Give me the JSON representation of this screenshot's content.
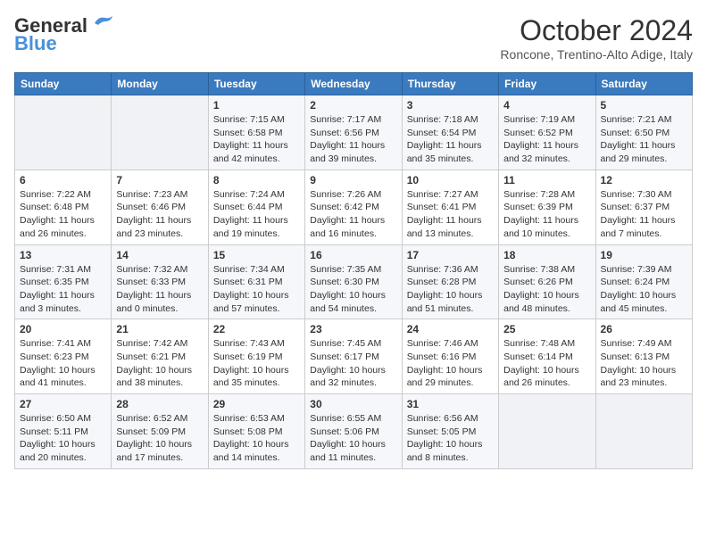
{
  "header": {
    "logo_line1": "General",
    "logo_line2": "Blue",
    "month": "October 2024",
    "location": "Roncone, Trentino-Alto Adige, Italy"
  },
  "days_of_week": [
    "Sunday",
    "Monday",
    "Tuesday",
    "Wednesday",
    "Thursday",
    "Friday",
    "Saturday"
  ],
  "weeks": [
    [
      {
        "day": "",
        "detail": ""
      },
      {
        "day": "",
        "detail": ""
      },
      {
        "day": "1",
        "detail": "Sunrise: 7:15 AM\nSunset: 6:58 PM\nDaylight: 11 hours and 42 minutes."
      },
      {
        "day": "2",
        "detail": "Sunrise: 7:17 AM\nSunset: 6:56 PM\nDaylight: 11 hours and 39 minutes."
      },
      {
        "day": "3",
        "detail": "Sunrise: 7:18 AM\nSunset: 6:54 PM\nDaylight: 11 hours and 35 minutes."
      },
      {
        "day": "4",
        "detail": "Sunrise: 7:19 AM\nSunset: 6:52 PM\nDaylight: 11 hours and 32 minutes."
      },
      {
        "day": "5",
        "detail": "Sunrise: 7:21 AM\nSunset: 6:50 PM\nDaylight: 11 hours and 29 minutes."
      }
    ],
    [
      {
        "day": "6",
        "detail": "Sunrise: 7:22 AM\nSunset: 6:48 PM\nDaylight: 11 hours and 26 minutes."
      },
      {
        "day": "7",
        "detail": "Sunrise: 7:23 AM\nSunset: 6:46 PM\nDaylight: 11 hours and 23 minutes."
      },
      {
        "day": "8",
        "detail": "Sunrise: 7:24 AM\nSunset: 6:44 PM\nDaylight: 11 hours and 19 minutes."
      },
      {
        "day": "9",
        "detail": "Sunrise: 7:26 AM\nSunset: 6:42 PM\nDaylight: 11 hours and 16 minutes."
      },
      {
        "day": "10",
        "detail": "Sunrise: 7:27 AM\nSunset: 6:41 PM\nDaylight: 11 hours and 13 minutes."
      },
      {
        "day": "11",
        "detail": "Sunrise: 7:28 AM\nSunset: 6:39 PM\nDaylight: 11 hours and 10 minutes."
      },
      {
        "day": "12",
        "detail": "Sunrise: 7:30 AM\nSunset: 6:37 PM\nDaylight: 11 hours and 7 minutes."
      }
    ],
    [
      {
        "day": "13",
        "detail": "Sunrise: 7:31 AM\nSunset: 6:35 PM\nDaylight: 11 hours and 3 minutes."
      },
      {
        "day": "14",
        "detail": "Sunrise: 7:32 AM\nSunset: 6:33 PM\nDaylight: 11 hours and 0 minutes."
      },
      {
        "day": "15",
        "detail": "Sunrise: 7:34 AM\nSunset: 6:31 PM\nDaylight: 10 hours and 57 minutes."
      },
      {
        "day": "16",
        "detail": "Sunrise: 7:35 AM\nSunset: 6:30 PM\nDaylight: 10 hours and 54 minutes."
      },
      {
        "day": "17",
        "detail": "Sunrise: 7:36 AM\nSunset: 6:28 PM\nDaylight: 10 hours and 51 minutes."
      },
      {
        "day": "18",
        "detail": "Sunrise: 7:38 AM\nSunset: 6:26 PM\nDaylight: 10 hours and 48 minutes."
      },
      {
        "day": "19",
        "detail": "Sunrise: 7:39 AM\nSunset: 6:24 PM\nDaylight: 10 hours and 45 minutes."
      }
    ],
    [
      {
        "day": "20",
        "detail": "Sunrise: 7:41 AM\nSunset: 6:23 PM\nDaylight: 10 hours and 41 minutes."
      },
      {
        "day": "21",
        "detail": "Sunrise: 7:42 AM\nSunset: 6:21 PM\nDaylight: 10 hours and 38 minutes."
      },
      {
        "day": "22",
        "detail": "Sunrise: 7:43 AM\nSunset: 6:19 PM\nDaylight: 10 hours and 35 minutes."
      },
      {
        "day": "23",
        "detail": "Sunrise: 7:45 AM\nSunset: 6:17 PM\nDaylight: 10 hours and 32 minutes."
      },
      {
        "day": "24",
        "detail": "Sunrise: 7:46 AM\nSunset: 6:16 PM\nDaylight: 10 hours and 29 minutes."
      },
      {
        "day": "25",
        "detail": "Sunrise: 7:48 AM\nSunset: 6:14 PM\nDaylight: 10 hours and 26 minutes."
      },
      {
        "day": "26",
        "detail": "Sunrise: 7:49 AM\nSunset: 6:13 PM\nDaylight: 10 hours and 23 minutes."
      }
    ],
    [
      {
        "day": "27",
        "detail": "Sunrise: 6:50 AM\nSunset: 5:11 PM\nDaylight: 10 hours and 20 minutes."
      },
      {
        "day": "28",
        "detail": "Sunrise: 6:52 AM\nSunset: 5:09 PM\nDaylight: 10 hours and 17 minutes."
      },
      {
        "day": "29",
        "detail": "Sunrise: 6:53 AM\nSunset: 5:08 PM\nDaylight: 10 hours and 14 minutes."
      },
      {
        "day": "30",
        "detail": "Sunrise: 6:55 AM\nSunset: 5:06 PM\nDaylight: 10 hours and 11 minutes."
      },
      {
        "day": "31",
        "detail": "Sunrise: 6:56 AM\nSunset: 5:05 PM\nDaylight: 10 hours and 8 minutes."
      },
      {
        "day": "",
        "detail": ""
      },
      {
        "day": "",
        "detail": ""
      }
    ]
  ]
}
